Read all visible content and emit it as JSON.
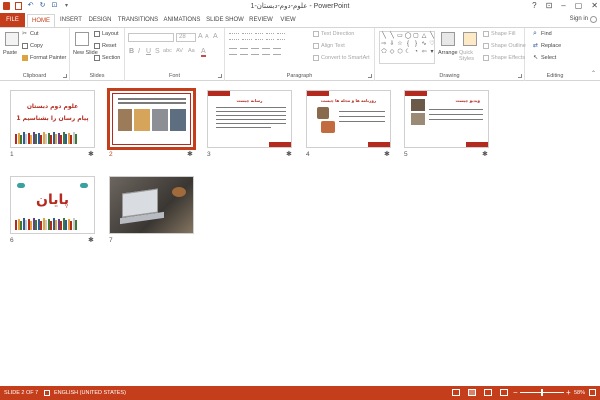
{
  "window": {
    "title": "علوم-دوم-دبستان-1 - PowerPoint",
    "sign_in": "Sign in",
    "help": "?",
    "minimize": "–",
    "restore": "▢",
    "close": "✕",
    "ribbon_display": "⊡"
  },
  "tabs": [
    "FILE",
    "HOME",
    "INSERT",
    "DESIGN",
    "TRANSITIONS",
    "ANIMATIONS",
    "SLIDE SHOW",
    "REVIEW",
    "VIEW"
  ],
  "active_tab": "HOME",
  "ribbon": {
    "clipboard": {
      "label": "Clipboard",
      "paste": "Paste",
      "cut": "Cut",
      "copy": "Copy",
      "format_painter": "Format Painter"
    },
    "slides": {
      "label": "Slides",
      "new_slide": "New Slide",
      "layout": "Layout",
      "reset": "Reset",
      "section": "Section"
    },
    "font": {
      "label": "Font",
      "font_size": "28",
      "bold": "B",
      "italic": "I",
      "underline": "U",
      "strikethrough": "S",
      "shadow": "abc",
      "spacing": "AV",
      "case": "Aa",
      "color": "A",
      "grow": "A",
      "shrink": "A",
      "clear": "A"
    },
    "paragraph": {
      "label": "Paragraph",
      "text_direction": "Text Direction",
      "align_text": "Align Text",
      "convert_smartart": "Convert to SmartArt"
    },
    "drawing": {
      "label": "Drawing",
      "arrange": "Arrange",
      "quick_styles": "Quick Styles",
      "shape_fill": "Shape Fill",
      "shape_outline": "Shape Outline",
      "shape_effects": "Shape Effects"
    },
    "editing": {
      "label": "Editing",
      "find": "Find",
      "replace": "Replace",
      "select": "Select"
    }
  },
  "slides": [
    {
      "number": "1",
      "title_line1": "علوم دوم دبستان",
      "title_line2": "پیام رسان را بشناسیم 1",
      "has_star": true
    },
    {
      "number": "2",
      "selected": true,
      "has_star": true
    },
    {
      "number": "3",
      "heading": "رسانه چیست",
      "has_star": true
    },
    {
      "number": "4",
      "heading": "روزنامه ها و مجله ها چیست",
      "has_star": true
    },
    {
      "number": "5",
      "heading": "ویدیو چیست",
      "has_star": true
    },
    {
      "number": "6",
      "title": "پایان",
      "has_star": true
    },
    {
      "number": "7",
      "has_star": false
    }
  ],
  "star": "✱",
  "status": {
    "slide_info": "SLIDE 2 OF 7",
    "language": "ENGLISH (UNITED STATES)",
    "zoom": "58%",
    "zoom_out": "−",
    "zoom_in": "+"
  }
}
